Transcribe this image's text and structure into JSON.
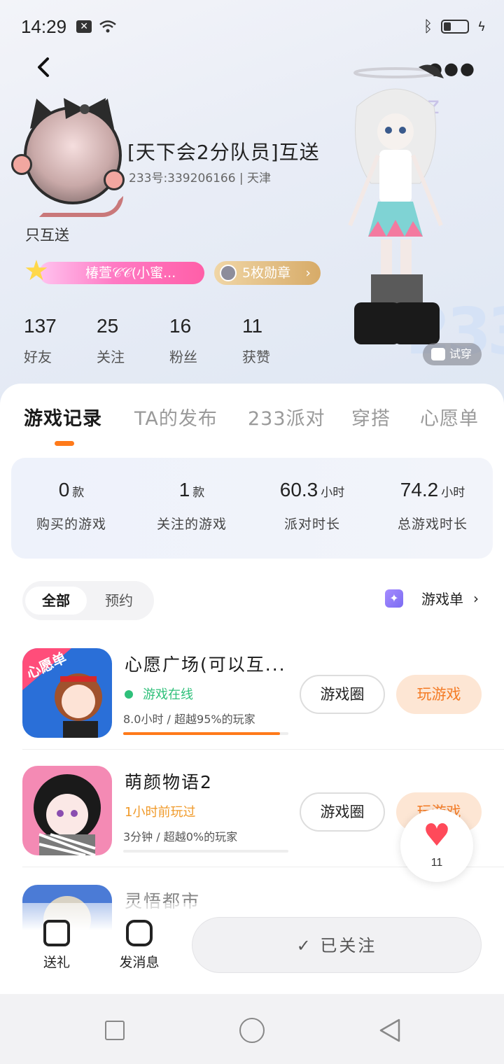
{
  "status_bar": {
    "time": "14:29"
  },
  "profile": {
    "username": "[天下会2分队员]互送",
    "id_line": "233号:339206166 | 天津",
    "bio": "只互送",
    "badge_label": "椿萱𝒞𝒞(小蜜...",
    "medal_label": "5枚勋章",
    "stats": [
      {
        "num": "137",
        "label": "好友"
      },
      {
        "num": "25",
        "label": "关注"
      },
      {
        "num": "16",
        "label": "粉丝"
      },
      {
        "num": "11",
        "label": "获赞"
      }
    ],
    "tryon_label": "试穿"
  },
  "tabs": [
    {
      "label": "游戏记录",
      "active": true
    },
    {
      "label": "TA的发布"
    },
    {
      "label": "233派对"
    },
    {
      "label": "穿搭"
    },
    {
      "label": "心愿单"
    }
  ],
  "summary": [
    {
      "value": "0",
      "unit": "款",
      "label": "购买的游戏"
    },
    {
      "value": "1",
      "unit": "款",
      "label": "关注的游戏"
    },
    {
      "value": "60.3",
      "unit": "小时",
      "label": "派对时长"
    },
    {
      "value": "74.2",
      "unit": "小时",
      "label": "总游戏时长"
    }
  ],
  "filters": {
    "all": "全部",
    "reserve": "预约"
  },
  "game_list_link": "游戏单",
  "games": [
    {
      "title": "心愿广场(可以互...",
      "status": "游戏在线",
      "status_color": "#2fc07a",
      "meta": "8.0小时 / 超越95%的玩家",
      "progress": 0.95,
      "circle_label": "游戏圈",
      "play_label": "玩游戏",
      "icon_text": "心愿单"
    },
    {
      "title": "萌颜物语2",
      "status": "1小时前玩过",
      "status_color": "#f09a2a",
      "meta": "3分钟 / 超越0%的玩家",
      "progress": 0.0,
      "circle_label": "游戏圈",
      "play_label": "玩游戏"
    },
    {
      "title": "灵悟都市"
    }
  ],
  "like_count": "11",
  "bottom": {
    "gift": "送礼",
    "message": "发消息",
    "followed": "已关注"
  }
}
